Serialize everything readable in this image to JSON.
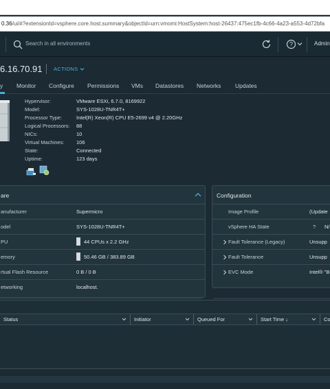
{
  "browser": {
    "url_host": "0.36",
    "url_path": "/ui/#?extensionId=vsphere.core.host.summary&objectId=urn:vmomi:HostSystem:host-26437:475ec1fb-4c66-4a23-a553-4d72bfa"
  },
  "header": {
    "search_placeholder": "Search in all environments",
    "user": "Admin"
  },
  "host": {
    "title": "6.16.70.91",
    "actions_label": "ACTIONS"
  },
  "tabs": [
    {
      "label": "y",
      "active": true
    },
    {
      "label": "Monitor"
    },
    {
      "label": "Configure"
    },
    {
      "label": "Permissions"
    },
    {
      "label": "VMs"
    },
    {
      "label": "Datastores"
    },
    {
      "label": "Networks"
    },
    {
      "label": "Updates"
    }
  ],
  "summary": [
    {
      "label": "Hypervisor:",
      "value": "VMware ESXi, 6.7.0, 8169922"
    },
    {
      "label": "Model:",
      "value": "SYS-1028U-TNR4T+"
    },
    {
      "label": "Processor Type:",
      "value": "Intel(R) Xeon(R) CPU E5-2699 v4 @ 2.20GHz"
    },
    {
      "label": "Logical Processors:",
      "value": "88"
    },
    {
      "label": "NICs:",
      "value": "10"
    },
    {
      "label": "Virtual Machines:",
      "value": "106"
    },
    {
      "label": "State:",
      "value": "Connected"
    },
    {
      "label": "Uptime:",
      "value": "123 days"
    }
  ],
  "hardware": {
    "title": "are",
    "rows": [
      {
        "label": "anufacturer",
        "value": "Supermicro"
      },
      {
        "label": "odel",
        "value": "SYS-1028U-TNR4T+"
      },
      {
        "label": "PU",
        "value": "44 CPUs x 2.2 GHz",
        "usage": 0.05
      },
      {
        "label": "emory",
        "value": "50.46 GB / 383.89 GB",
        "usage": 0.13
      },
      {
        "label": "rtual Flash Resource",
        "value": "0 B / 0 B"
      },
      {
        "label": "etworking",
        "value": "localhost."
      }
    ]
  },
  "configuration": {
    "title": "Configuration",
    "rows": [
      {
        "label": "Image Profile",
        "value": "(Update",
        "expandable": false
      },
      {
        "label": "vSphere HA State",
        "value": "?",
        "value2": "N/",
        "expandable": false
      },
      {
        "label": "Fault Tolerance (Legacy)",
        "value": "Unsupp",
        "expandable": true
      },
      {
        "label": "Fault Tolerance",
        "value": "Unsupp",
        "expandable": true
      },
      {
        "label": "EVC Mode",
        "value": "Intel® \"B",
        "expandable": true
      }
    ]
  },
  "tasks": {
    "columns": [
      {
        "label": "Status"
      },
      {
        "label": "Initiator"
      },
      {
        "label": "Queued For"
      },
      {
        "label": "Start Time ↓"
      },
      {
        "label": "Co"
      }
    ]
  },
  "colors": {
    "accent": "#49afd9",
    "background": "#1b2a33",
    "panel": "#22343c"
  }
}
